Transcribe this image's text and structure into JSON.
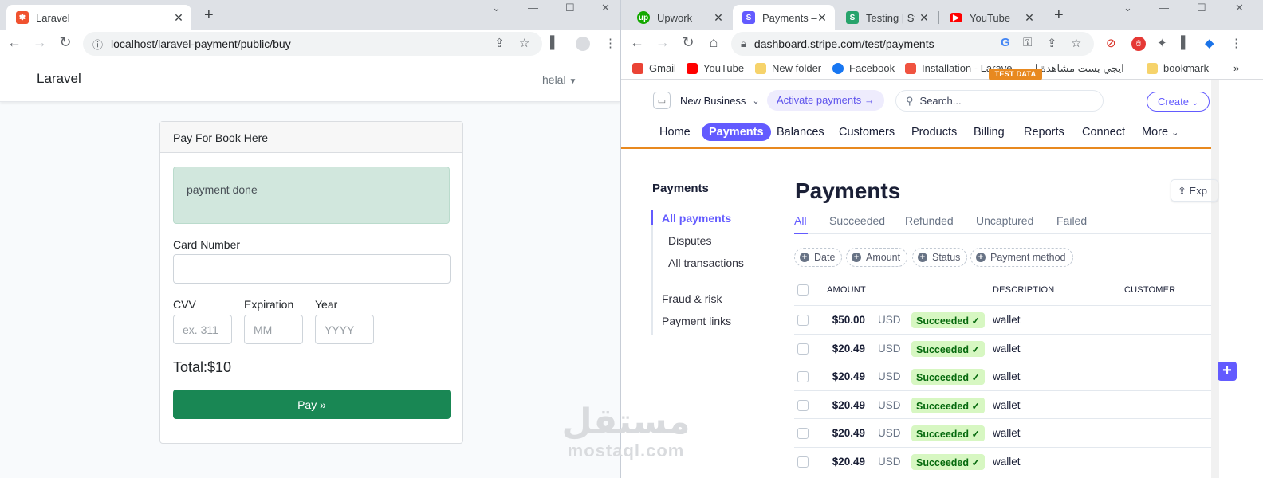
{
  "left_window": {
    "tab_title": "Laravel",
    "url": "localhost/laravel-payment/public/buy",
    "app": {
      "brand": "Laravel",
      "user": "helal"
    },
    "card": {
      "header": "Pay For Book Here",
      "alert": "payment done",
      "card_number_label": "Card Number",
      "card_number_value": "",
      "cvv_label": "CVV",
      "cvv_placeholder": "ex. 311",
      "expiration_label": "Expiration",
      "expiration_placeholder": "MM",
      "year_label": "Year",
      "year_placeholder": "YYYY",
      "total": "Total:$10",
      "pay_button": "Pay »"
    }
  },
  "right_window": {
    "tabs": [
      {
        "title": "Upwork",
        "icon": "upwork-icon"
      },
      {
        "title": "Payments – ",
        "icon": "stripe-icon"
      },
      {
        "title": "Testing | Strip",
        "icon": "stripe-docs-icon"
      },
      {
        "title": "YouTube",
        "icon": "youtube-icon"
      }
    ],
    "url": "dashboard.stripe.com/test/payments",
    "bookmarks": [
      "Gmail",
      "YouTube",
      "New folder",
      "Facebook",
      "Installation - Larave...",
      "ايجي بست مشاهدة ا...",
      "bookmark"
    ],
    "stripe": {
      "account": "New Business",
      "activate": "Activate payments →",
      "search_placeholder": "Search...",
      "create": "Create",
      "nav": [
        "Home",
        "Payments",
        "Balances",
        "Customers",
        "Products",
        "Billing",
        "Reports",
        "Connect",
        "More"
      ],
      "active_nav": "Payments",
      "test_badge": "TEST DATA",
      "sidebar": {
        "heading": "Payments",
        "items": [
          "All payments",
          "Disputes",
          "All transactions",
          "Fraud & risk",
          "Payment links"
        ]
      },
      "page_title": "Payments",
      "export_label": "Exp",
      "filter_tabs": [
        "All",
        "Succeeded",
        "Refunded",
        "Uncaptured",
        "Failed"
      ],
      "filter_chips": [
        "Date",
        "Amount",
        "Status",
        "Payment method"
      ],
      "columns": [
        "AMOUNT",
        "DESCRIPTION",
        "CUSTOMER"
      ],
      "rows": [
        {
          "amount": "$50.00",
          "currency": "USD",
          "status": "Succeeded ✓",
          "description": "wallet"
        },
        {
          "amount": "$20.49",
          "currency": "USD",
          "status": "Succeeded ✓",
          "description": "wallet"
        },
        {
          "amount": "$20.49",
          "currency": "USD",
          "status": "Succeeded ✓",
          "description": "wallet"
        },
        {
          "amount": "$20.49",
          "currency": "USD",
          "status": "Succeeded ✓",
          "description": "wallet"
        },
        {
          "amount": "$20.49",
          "currency": "USD",
          "status": "Succeeded ✓",
          "description": "wallet"
        },
        {
          "amount": "$20.49",
          "currency": "USD",
          "status": "Succeeded ✓",
          "description": "wallet"
        }
      ]
    }
  },
  "watermark": {
    "arabic": "مستقل",
    "latin": "mostaql.com"
  },
  "colors": {
    "stripe_accent": "#635bff",
    "test_mode": "#e8891f",
    "success_bg": "#d7f7c2",
    "pay_button": "#198754",
    "alert_bg": "#d1e7dd"
  }
}
